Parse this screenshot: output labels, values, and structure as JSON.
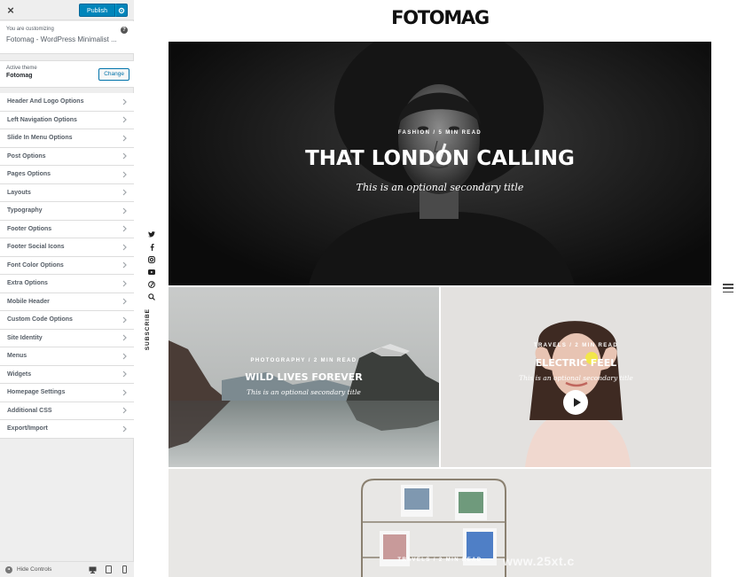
{
  "sidebar": {
    "close_label": "×",
    "publish_label": "Publish",
    "customizing_label": "You are customizing",
    "site_title": "Fotomag - WordPress Minimalist ...",
    "help_label": "?",
    "active_theme_label": "Active theme",
    "theme_name": "Fotomag",
    "change_label": "Change",
    "panels": [
      {
        "label": "Header And Logo Options"
      },
      {
        "label": "Left Navigation Options"
      },
      {
        "label": "Slide In Menu Options"
      },
      {
        "label": "Post Options"
      },
      {
        "label": "Pages Options"
      },
      {
        "label": "Layouts"
      },
      {
        "label": "Typography"
      },
      {
        "label": "Footer Options"
      },
      {
        "label": "Footer Social Icons"
      },
      {
        "label": "Font Color Options"
      },
      {
        "label": "Extra Options"
      },
      {
        "label": "Mobile Header"
      },
      {
        "label": "Custom Code Options"
      },
      {
        "label": "Site Identity"
      },
      {
        "label": "Menus"
      },
      {
        "label": "Widgets"
      },
      {
        "label": "Homepage Settings"
      },
      {
        "label": "Additional CSS"
      },
      {
        "label": "Export/Import"
      }
    ],
    "hide_controls_label": "Hide Controls"
  },
  "preview": {
    "logo": "FOTOMAG",
    "subscribe_label": "SUBSCRIBE",
    "hero": {
      "meta": "FASHION  /  5 MIN READ",
      "title": "THAT LONDON CALLING",
      "subtitle": "This is an optional secondary title"
    },
    "card_a": {
      "meta": "PHOTOGRAPHY  /  2 MIN READ",
      "title": "WILD LIVES FOREVER",
      "subtitle": "This is an optional secondary title"
    },
    "card_b": {
      "meta": "TRAVELS  /  2 MIN READ",
      "title": "ELECTRIC FEEL",
      "subtitle": "This is an optional secondary title"
    },
    "card_c": {
      "meta": "TRAVELS  /  2 MIN READ"
    }
  },
  "watermark": "www.25xt.c",
  "colors": {
    "primary_button": "#0085ba",
    "sidebar_bg": "#eeeeee",
    "panel_text": "#555d66"
  }
}
